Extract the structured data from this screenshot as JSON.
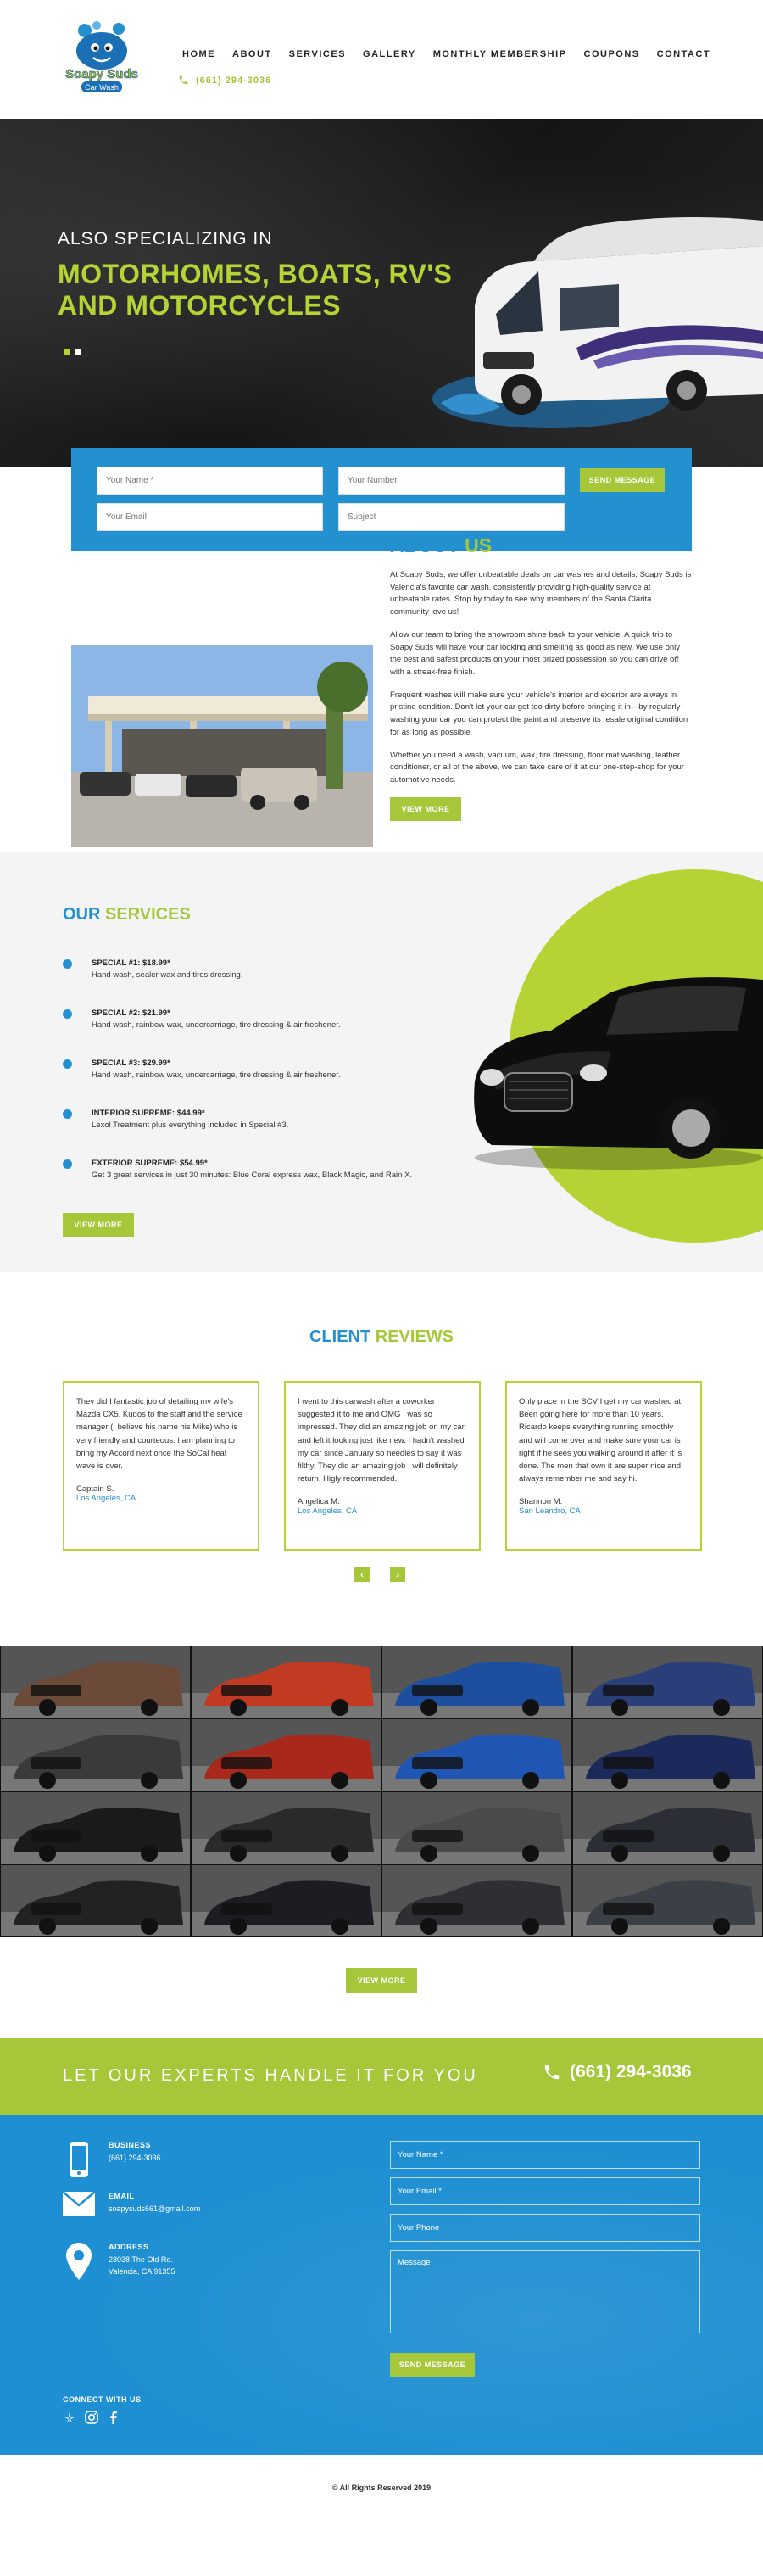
{
  "brand": {
    "logo_line1": "Soapy Suds",
    "logo_line2": "Car Wash"
  },
  "nav": {
    "items": [
      "HOME",
      "ABOUT",
      "SERVICES",
      "GALLERY",
      "MONTHLY MEMBERSHIP",
      "COUPONS",
      "CONTACT"
    ],
    "phone": "(661) 294-3036"
  },
  "hero": {
    "subtitle": "ALSO SPECIALIZING IN",
    "title": "MOTORHOMES, BOATS, RV'S AND MOTORCYCLES"
  },
  "quick_form": {
    "name_placeholder": "Your Name *",
    "number_placeholder": "Your Number",
    "email_placeholder": "Your Email",
    "subject_placeholder": "Subject",
    "submit_label": "SEND MESSAGE"
  },
  "about": {
    "title_a": "ABOUT",
    "title_b": "US",
    "paragraphs": [
      "At Soapy Suds, we offer unbeatable deals on car washes and details. Soapy Suds is Valencia's favorite car wash, consistently providing high-quality service at unbeatable rates. Stop by today to see why members of the Santa Clarita community love us!",
      "Allow our team to bring the showroom shine back to your vehicle. A quick trip to Soapy Suds will have your car looking and smelling as good as new. We use only the best and safest products on your most prized possession so you can drive off with a streak-free finish.",
      "Frequent washes will make sure your vehicle's interior and exterior are always in pristine condition. Don't let your car get too dirty before bringing it in—by regularly washing your car you can protect the paint and preserve its resale original condition for as long as possible.",
      "Whether you need a wash, vacuum, wax, tire dressing, floor mat washing, leather conditioner, or all of the above, we can take care of it at our one-step-shop for your automotive needs."
    ],
    "button_label": "VIEW MORE"
  },
  "services": {
    "title_a": "OUR",
    "title_b": "SERVICES",
    "items": [
      {
        "title": "SPECIAL #1: $18.99*",
        "desc": "Hand wash, sealer wax and tires dressing."
      },
      {
        "title": "SPECIAL #2: $21.99*",
        "desc": "Hand wash, rainbow wax, undercarriage, tire dressing & air freshener."
      },
      {
        "title": "SPECIAL #3: $29.99*",
        "desc": "Hand wash, rainbow wax, undercarriage, tire dressing & air freshener."
      },
      {
        "title": "INTERIOR SUPREME: $44.99*",
        "desc": "Lexol Treatment plus everything included in Special #3."
      },
      {
        "title": "EXTERIOR SUPREME: $54.99*",
        "desc": "Get 3 great services in just 30 minutes: Blue Coral express wax, Black Magic, and Rain X."
      }
    ],
    "button_label": "VIEW MORE"
  },
  "reviews": {
    "title_a": "CLIENT",
    "title_b": "REVIEWS",
    "items": [
      {
        "text": "They did I fantastic job of detailing my wife's Mazda CX5. Kudos to the staff and the service manager (I believe his name his Mike) who is very friendly and courteous. I am planning to bring my Accord next once the SoCal heat wave is over.",
        "name": "Captain S.",
        "location": "Los Angeles, CA"
      },
      {
        "text": "I went to this carwash after a coworker suggested it to me and OMG I was so impressed. They did an amazing job on my car and left it looking just like new. I hadn't washed my car since January so needles to say it was filthy. They did an amazing job I will definitely return. Higly recommended.",
        "name": "Angelica M.",
        "location": "Los Angeles, CA"
      },
      {
        "text": "Only place in the SCV I get my car washed at. Been going here for more than 10 years, Ricardo keeps everything running smoothly and will come over and make sure your car is right if he sees you walking around it after it is done. The men that own it are super nice and always remember me and say hi.",
        "name": "Shannon M.",
        "location": "San Leandro, CA"
      }
    ],
    "prev_label": "‹",
    "next_label": "›"
  },
  "gallery": {
    "button_label": "VIEW MORE",
    "tiles": [
      "#6b4a3a",
      "#c23a22",
      "#1d4f9e",
      "#2a3f7a",
      "#3a3a3a",
      "#a8281c",
      "#1f56b3",
      "#1b2a5a",
      "#1a1a1a",
      "#2a2a2a",
      "#4a4a4a",
      "#2b2f35",
      "#222",
      "#1c1c22",
      "#2e2e33",
      "#3b3f46"
    ]
  },
  "cta": {
    "text": "LET OUR EXPERTS HANDLE IT FOR YOU",
    "phone": "(661) 294-3036"
  },
  "contact": {
    "business_label": "BUSINESS",
    "business_value": "(661) 294-3036",
    "email_label": "EMAIL",
    "email_value": "soapysuds661@gmail.com",
    "address_label": "ADDRESS",
    "address_line1": "28038 The Old Rd.",
    "address_line2": "Valencia, CA 91355",
    "connect_label": "CONNECT WITH US",
    "form": {
      "name_placeholder": "Your Name *",
      "email_placeholder": "Your Email *",
      "phone_placeholder": "Your Phone",
      "message_placeholder": "Message",
      "submit_label": "SEND MESSAGE"
    }
  },
  "footer": {
    "copyright": "© All Rights Reserved 2019"
  },
  "colors": {
    "blue": "#2391cf",
    "green": "#a6c73a",
    "lime": "#b5d334"
  }
}
